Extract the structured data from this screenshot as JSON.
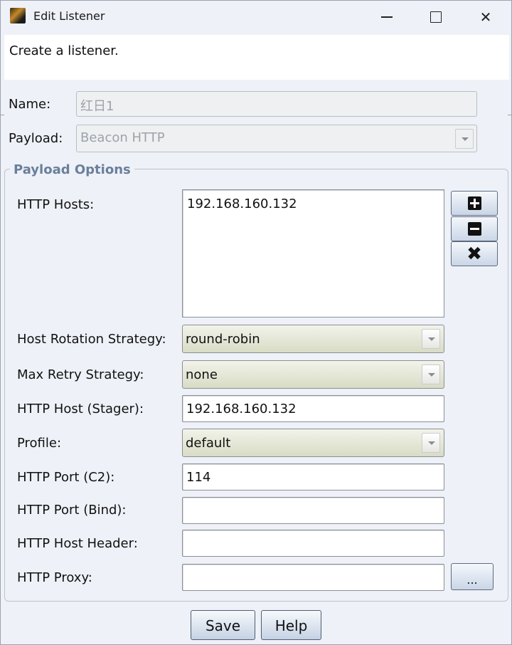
{
  "window": {
    "title": "Edit Listener"
  },
  "header": {
    "description": "Create a listener."
  },
  "form": {
    "name_label": "Name:",
    "name_value": "红日1",
    "payload_label": "Payload:",
    "payload_value": "Beacon HTTP"
  },
  "payload_options": {
    "title": "Payload Options",
    "http_hosts_label": "HTTP Hosts:",
    "http_hosts": [
      "192.168.160.132"
    ],
    "host_rotation_label": "Host Rotation Strategy:",
    "host_rotation_value": "round-robin",
    "max_retry_label": "Max Retry Strategy:",
    "max_retry_value": "none",
    "stager_host_label": "HTTP Host (Stager):",
    "stager_host_value": "192.168.160.132",
    "profile_label": "Profile:",
    "profile_value": "default",
    "port_c2_label": "HTTP Port (C2):",
    "port_c2_value": "114",
    "port_bind_label": "HTTP Port (Bind):",
    "port_bind_value": "",
    "host_header_label": "HTTP Host Header:",
    "host_header_value": "",
    "proxy_label": "HTTP Proxy:",
    "proxy_value": "",
    "proxy_button": "..."
  },
  "buttons": {
    "save": "Save",
    "help": "Help"
  },
  "icons": {
    "add": "plus-square-icon",
    "remove": "minus-square-icon",
    "clear": "x-icon"
  }
}
